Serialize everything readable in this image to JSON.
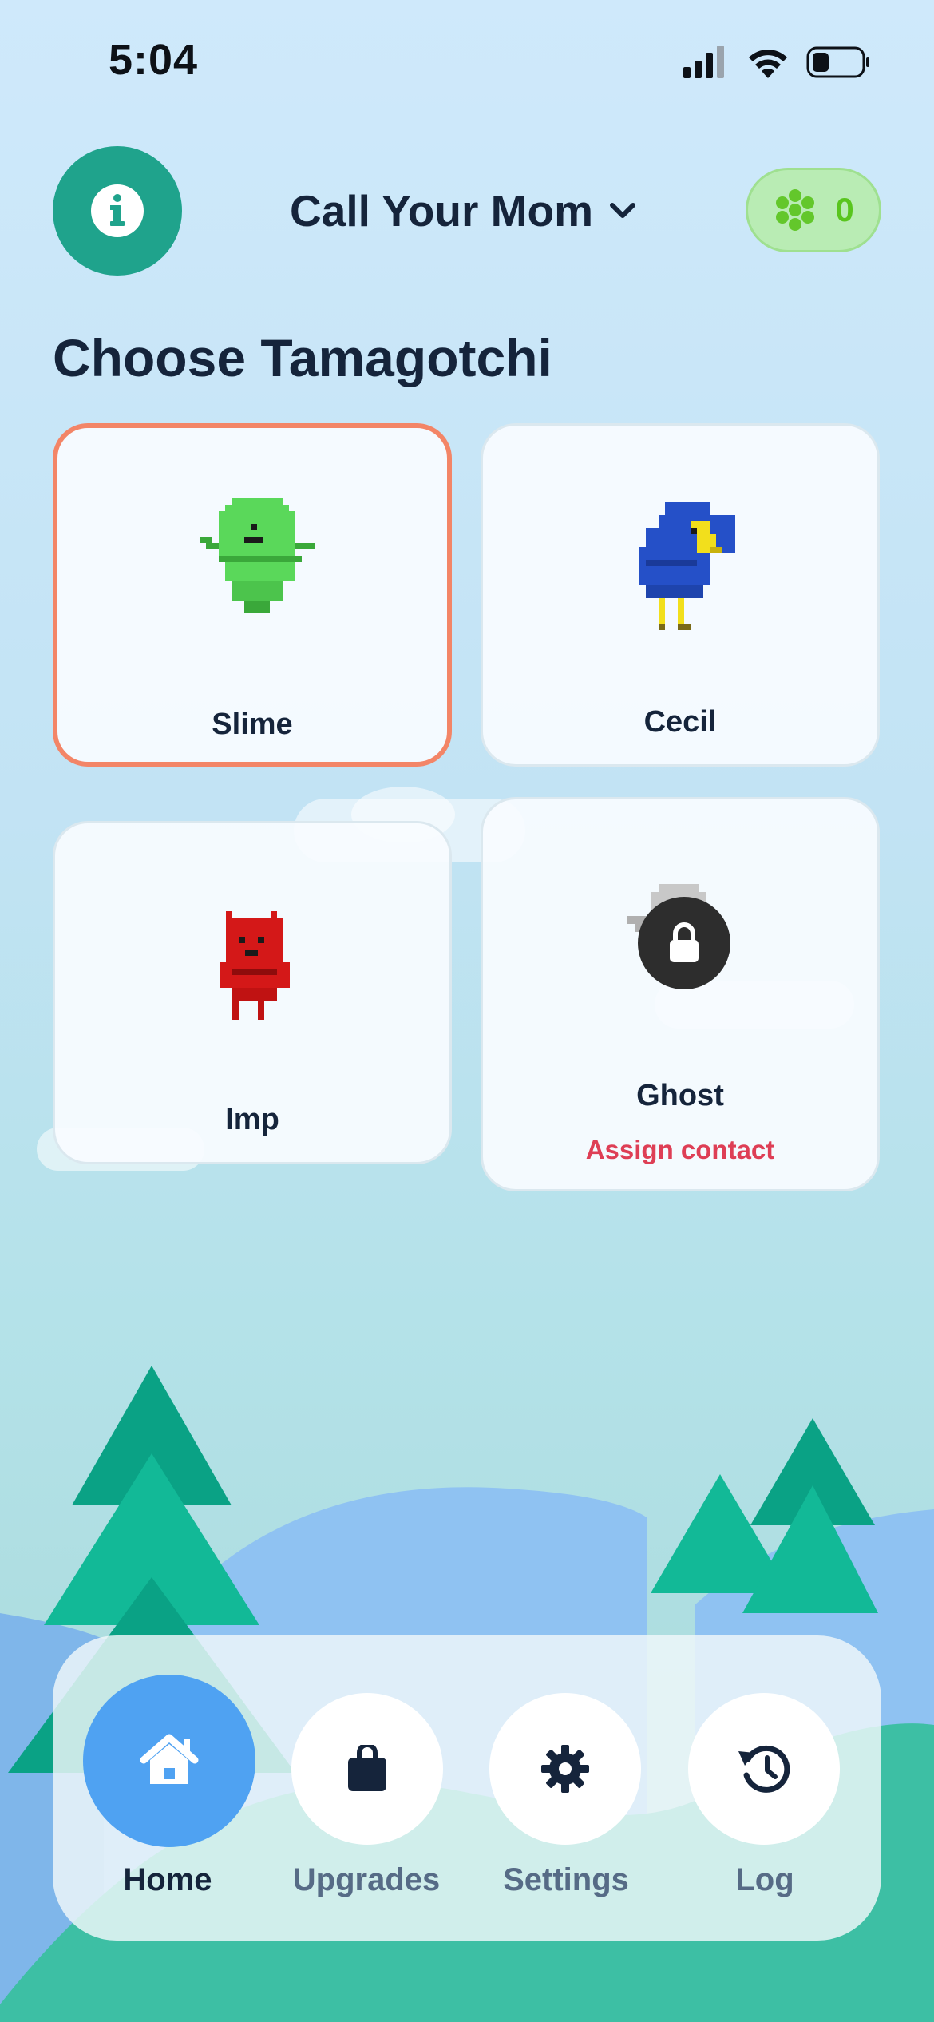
{
  "status_bar": {
    "time": "5:04",
    "icons": [
      "signal-icon",
      "wifi-icon",
      "battery-icon"
    ]
  },
  "header": {
    "info_icon": "info-icon",
    "contact_name": "Call Your Mom",
    "dropdown_icon": "chevron-down-icon",
    "coin_icon": "clover-coin-icon",
    "coin_count": "0"
  },
  "section_title": "Choose Tamagotchi",
  "pets": [
    {
      "name": "Slime",
      "selected": true,
      "locked": false,
      "subtext": ""
    },
    {
      "name": "Cecil",
      "selected": false,
      "locked": false,
      "subtext": ""
    },
    {
      "name": "Imp",
      "selected": false,
      "locked": false,
      "subtext": ""
    },
    {
      "name": "Ghost",
      "selected": false,
      "locked": true,
      "subtext": "Assign contact"
    }
  ],
  "tabs": [
    {
      "label": "Home",
      "icon": "home-icon",
      "active": true
    },
    {
      "label": "Upgrades",
      "icon": "shopping-bag-icon",
      "active": false
    },
    {
      "label": "Settings",
      "icon": "gear-icon",
      "active": false
    },
    {
      "label": "Log",
      "icon": "history-icon",
      "active": false
    }
  ],
  "colors": {
    "accent_teal": "#1fa38c",
    "selected_border": "#f38567",
    "active_tab": "#4fa2f2",
    "warning_text": "#de3e55",
    "coin_green": "#59c51e"
  }
}
